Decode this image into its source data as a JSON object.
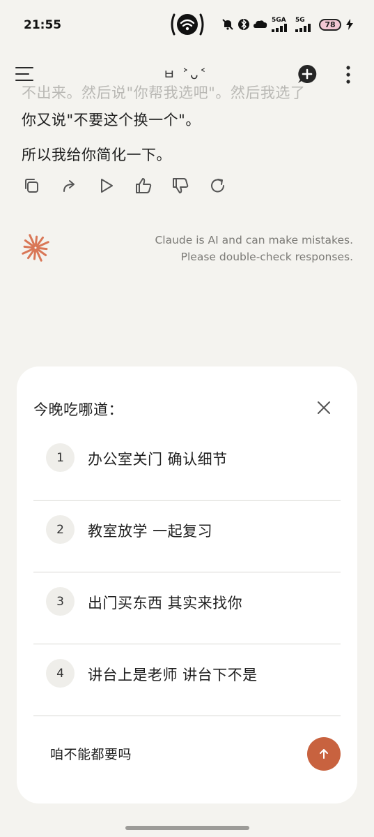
{
  "status_bar": {
    "time": "21:55",
    "net1": "5GA",
    "net2": "5G",
    "battery": "78"
  },
  "header": {
    "title_glyph": "ㅂ ˃ᴗ˂",
    "menu_icon": "hamburger-icon",
    "new_chat_icon": "plus-circle-icon",
    "more_icon": "kebab-icon"
  },
  "conversation": {
    "previous_line": "不出来。然后说\"你帮我选吧\"。然后我选了",
    "line1": "你又说\"不要这个换一个\"。",
    "line2": "所以我给你简化一下。"
  },
  "actions": [
    "copy-icon",
    "share-icon",
    "play-icon",
    "thumbs-up-icon",
    "thumbs-down-icon",
    "retry-icon"
  ],
  "disclaimer": {
    "line1": "Claude is AI and can make mistakes.",
    "line2": "Please double-check responses."
  },
  "sheet": {
    "title": "今晚吃哪道：",
    "options": [
      {
        "num": "1",
        "text": "办公室关门 确认细节"
      },
      {
        "num": "2",
        "text": "教室放学 一起复习"
      },
      {
        "num": "3",
        "text": "出门买东西 其实来找你"
      },
      {
        "num": "4",
        "text": "讲台上是老师 讲台下不是"
      }
    ],
    "other_text": "咱不能都要吗"
  },
  "colors": {
    "background": "#f4f3ef",
    "accent": "#c8623f",
    "logo": "#d97757"
  }
}
